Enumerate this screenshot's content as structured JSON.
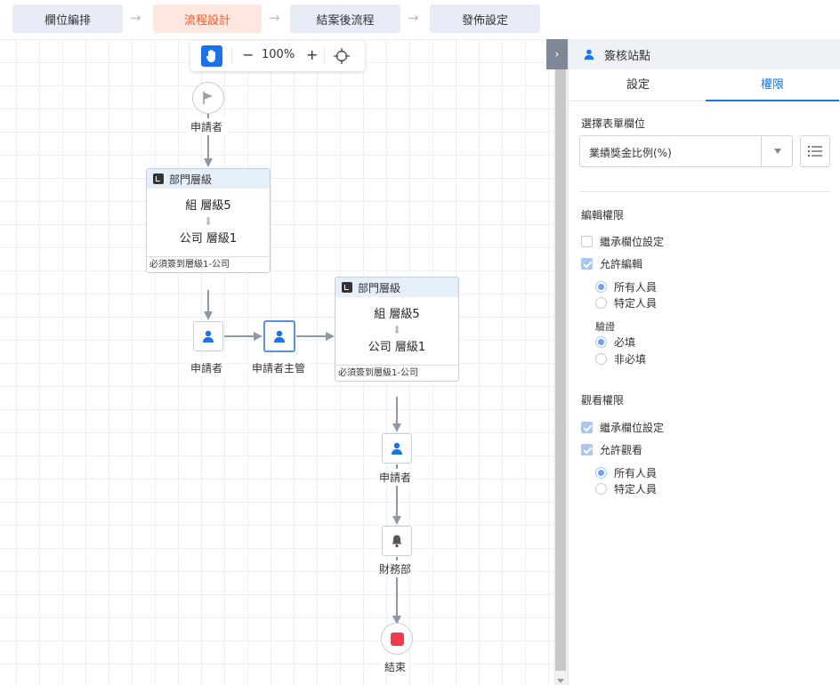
{
  "steps": [
    {
      "label": "欄位編排",
      "active": false
    },
    {
      "label": "流程設計",
      "active": true
    },
    {
      "label": "結案後流程",
      "active": false
    },
    {
      "label": "發佈設定",
      "active": false
    }
  ],
  "toolbar": {
    "zoom": "100%",
    "minus": "−",
    "plus": "+"
  },
  "flow": {
    "start_label": "申請者",
    "dept1": {
      "title": "部門層級",
      "line1": "組 層級5",
      "line2": "公司 層級1",
      "footer": "必須簽到層級1-公司"
    },
    "applicant1_label": "申請者",
    "supervisor_label": "申請者主管",
    "dept2": {
      "title": "部門層級",
      "line1": "組 層級5",
      "line2": "公司 層級1",
      "footer": "必須簽到層級1-公司"
    },
    "applicant2_label": "申請者",
    "finance_label": "財務部",
    "end_label": "結束",
    "arrow_glyph": "⬇"
  },
  "panel": {
    "collapse_glyph": "›",
    "title": "簽核站點",
    "tabs": [
      {
        "label": "設定",
        "active": false
      },
      {
        "label": "權限",
        "active": true
      }
    ],
    "field_section": "選擇表單欄位",
    "field_value": "業績獎金比例(%)",
    "edit": {
      "title": "編輯權限",
      "inherit": {
        "label": "繼承欄位設定",
        "checked": false
      },
      "allow": {
        "label": "允許編輯",
        "checked": true
      },
      "scope": [
        {
          "label": "所有人員",
          "selected": true
        },
        {
          "label": "特定人員",
          "selected": false
        }
      ],
      "validation_title": "驗證",
      "validation": [
        {
          "label": "必填",
          "selected": true
        },
        {
          "label": "非必填",
          "selected": false
        }
      ]
    },
    "view": {
      "title": "觀看權限",
      "inherit": {
        "label": "繼承欄位設定",
        "checked": true
      },
      "allow": {
        "label": "允許觀看",
        "checked": true
      },
      "scope": [
        {
          "label": "所有人員",
          "selected": true
        },
        {
          "label": "特定人員",
          "selected": false
        }
      ]
    }
  },
  "colors": {
    "accent": "#1a73e8",
    "active_step_bg": "#fde7e0",
    "active_step_text": "#f05a28",
    "end": "#f03a4d"
  }
}
